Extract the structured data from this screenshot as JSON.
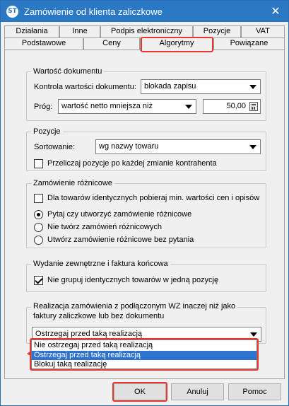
{
  "window": {
    "title": "Zamówienie od klienta zaliczkowe",
    "app_icon": "app-logo-icon",
    "close_glyph": "✕"
  },
  "tabs_row1": [
    {
      "label": "Działania"
    },
    {
      "label": "Inne"
    },
    {
      "label": "Podpis elektroniczny"
    },
    {
      "label": "Pozycje"
    },
    {
      "label": "VAT"
    }
  ],
  "tabs_row2": [
    {
      "label": "Podstawowe"
    },
    {
      "label": "Ceny"
    },
    {
      "label": "Algorytmy",
      "active": true
    },
    {
      "label": "Powiązane"
    }
  ],
  "wartosc": {
    "legend": "Wartość dokumentu",
    "kontrola_label": "Kontrola wartości dokumentu:",
    "kontrola_value": "blokada zapisu",
    "prog_label": "Próg:",
    "prog_value": "wartość netto mniejsza niż",
    "prog_amount": "50,00"
  },
  "pozycje": {
    "legend": "Pozycje",
    "sort_label": "Sortowanie:",
    "sort_value": "wg nazwy towaru",
    "recalc_label": "Przeliczaj pozycje po każdej zmianie kontrahenta",
    "recalc_checked": false
  },
  "roznicowe": {
    "legend": "Zamówienie różnicowe",
    "min_label": "Dla towarów identycznych pobieraj min. wartości cen i opisów",
    "min_checked": false,
    "options": [
      {
        "label": "Pytaj czy utworzyć zamówienie różnicowe",
        "checked": true
      },
      {
        "label": "Nie twórz zamówień różnicowych",
        "checked": false
      },
      {
        "label": "Utwórz zamówienie różnicowe bez pytania",
        "checked": false
      }
    ]
  },
  "wydanie": {
    "legend": "Wydanie zewnętrzne i faktura końcowa",
    "nogroup_label": "Nie grupuj identycznych towarów w jedną pozycję",
    "nogroup_checked": true
  },
  "realizacja": {
    "legend_line1": "Realizacja zamówienia z podłączonym WZ inaczej niż jako",
    "legend_line2": "faktury zaliczkowe lub bez dokumentu",
    "value": "Ostrzegaj przed taką realizacją",
    "options": [
      {
        "label": "Nie ostrzegaj przed taką realizacją",
        "selected": false
      },
      {
        "label": "Ostrzegaj przed taką realizacją",
        "selected": true
      },
      {
        "label": "Blokuj taką realizację",
        "selected": false
      }
    ]
  },
  "buttons": {
    "ok": "OK",
    "cancel": "Anuluj",
    "help": "Pomoc"
  },
  "colors": {
    "titlebar": "#2b78c5",
    "highlight": "#e53935",
    "selection": "#2f73d0"
  }
}
